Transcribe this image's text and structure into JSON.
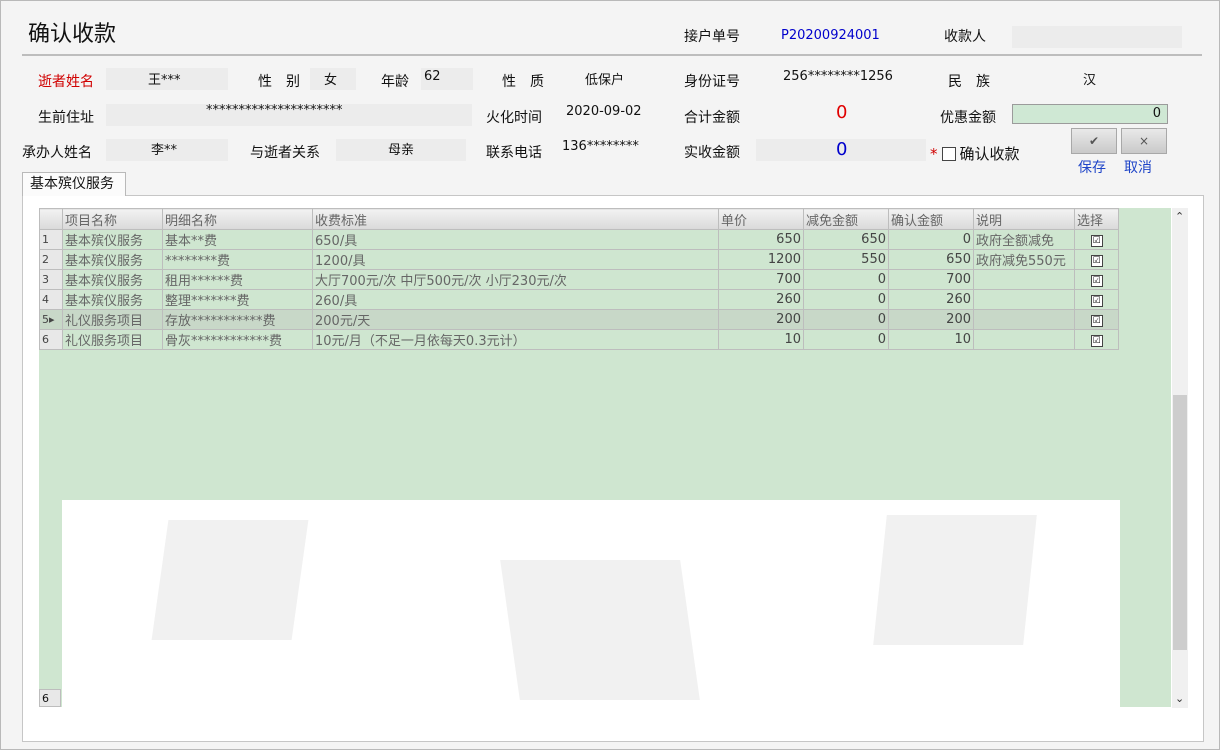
{
  "title": "确认收款",
  "receipt_no_label": "接户单号",
  "receipt_no": "P20200924001",
  "payee_label": "收款人",
  "payee_value": "",
  "deceased_name_label": "逝者姓名",
  "deceased_name": "王***",
  "gender_label": "性　别",
  "gender": "女",
  "age_label": "年龄",
  "age": "62",
  "nature_label": "性　质",
  "nature": "低保户",
  "id_label": "身份证号",
  "id_no": "256********1256",
  "ethnicity_label": "民　族",
  "ethnicity": "汉",
  "address_label": "生前住址",
  "address": "*********************",
  "cremation_label": "火化时间",
  "cremation_date": "2020-09-02",
  "total_label": "合计金额",
  "total_amount": "0",
  "discount_label": "优惠金额",
  "discount_amount": "0",
  "agent_label": "承办人姓名",
  "agent_name": "李**",
  "relation_label": "与逝者关系",
  "relation": "母亲",
  "phone_label": "联系电话",
  "phone": "136********",
  "received_label": "实收金额",
  "received_amount": "0",
  "confirm_star": "*",
  "confirm_label": "确认收款",
  "save_icon_glyph": "✔",
  "cancel_icon_glyph": "×",
  "save_label": "保存",
  "cancel_label": "取消",
  "tab_label": "基本殡仪服务",
  "table": {
    "headers": [
      "项目名称",
      "明细名称",
      "收费标准",
      "单价",
      "减免金额",
      "确认金额",
      "说明",
      "选择"
    ],
    "rows": [
      {
        "no": "1",
        "project": "基本殡仪服务",
        "detail": "基本**费",
        "standard": "650/具",
        "price": "650",
        "reduction": "650",
        "confirmed": "0",
        "note": "政府全额减免",
        "checked": "☑"
      },
      {
        "no": "2",
        "project": "基本殡仪服务",
        "detail": "********费",
        "standard": "1200/具",
        "price": "1200",
        "reduction": "550",
        "confirmed": "650",
        "note": "政府减免550元",
        "checked": "☑"
      },
      {
        "no": "3",
        "project": "基本殡仪服务",
        "detail": "租用******费",
        "standard": "大厅700元/次 中厅500元/次 小厅230元/次",
        "price": "700",
        "reduction": "0",
        "confirmed": "700",
        "note": "",
        "checked": "☑"
      },
      {
        "no": "4",
        "project": "基本殡仪服务",
        "detail": "整理*******费",
        "standard": "260/具",
        "price": "260",
        "reduction": "0",
        "confirmed": "260",
        "note": "",
        "checked": "☑"
      },
      {
        "no": "5",
        "project": "礼仪服务项目",
        "detail": "存放***********费",
        "standard": "200元/天",
        "price": "200",
        "reduction": "0",
        "confirmed": "200",
        "note": "",
        "checked": "☑"
      },
      {
        "no": "6",
        "project": "礼仪服务项目",
        "detail": "骨灰************费",
        "standard": "10元/月（不足一月依每天0.3元计）",
        "price": "10",
        "reduction": "0",
        "confirmed": "10",
        "note": "",
        "checked": "☑"
      }
    ],
    "row_count": "6",
    "selected_row": "5"
  },
  "colors": {
    "grid_green": "#cfe6d0",
    "red_label": "#d00000",
    "blue_value": "#0000cc",
    "action_blue": "#1f45c8"
  }
}
